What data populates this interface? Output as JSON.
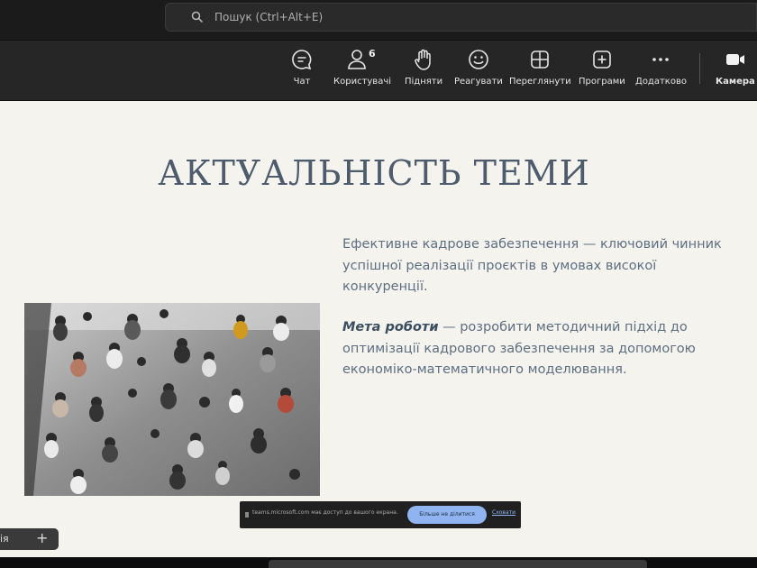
{
  "search": {
    "placeholder": "Пошук (Ctrl+Alt+E)"
  },
  "toolbar": {
    "items": [
      {
        "label": "Чат",
        "icon": "chat-icon"
      },
      {
        "label": "Користувачі",
        "icon": "people-icon",
        "count": "6"
      },
      {
        "label": "Підняти",
        "icon": "raise-hand-icon"
      },
      {
        "label": "Реагувати",
        "icon": "react-icon"
      },
      {
        "label": "Переглянути",
        "icon": "view-grid-icon"
      },
      {
        "label": "Програми",
        "icon": "apps-icon"
      },
      {
        "label": "Додатково",
        "icon": "more-icon"
      },
      {
        "label": "Камера",
        "icon": "camera-icon"
      }
    ]
  },
  "slide": {
    "title": "АКТУАЛЬНІСТЬ ТЕМИ",
    "paragraph1": "Ефективне кадрове забезпечення — ключовий чинник успішної реалізації проєктів в умовах високої конкуренції.",
    "goal_label": "Мета роботи",
    "goal_text": " — розробити методичний підхід до оптимізації кадрового забезпечення за допомогою економіко-математичного моделювання."
  },
  "notice": {
    "text": "teams.microsoft.com має доступ до вашого екрана.",
    "share_button": "Більше не ділитися",
    "hide_link": "Сховати"
  },
  "side_tab": {
    "label": "ія"
  },
  "colors": {
    "slide_bg": "#f4f3ee",
    "title": "#4d5b6c",
    "body_text": "#5e6f81",
    "toolbar_bg": "#262626"
  }
}
